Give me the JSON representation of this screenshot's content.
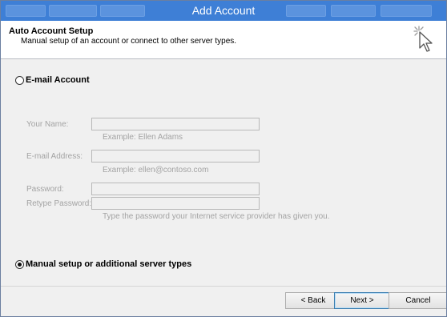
{
  "window": {
    "title": "Add Account"
  },
  "header": {
    "heading": "Auto Account Setup",
    "subheading": "Manual setup of an account or connect to other server types."
  },
  "email_option": {
    "label": "E-mail Account",
    "selected": false
  },
  "form": {
    "name_label": "Your Name:",
    "name_value": "",
    "name_hint": "Example: Ellen Adams",
    "email_label": "E-mail Address:",
    "email_value": "",
    "email_hint": "Example: ellen@contoso.com",
    "password_label": "Password:",
    "password_value": "",
    "retype_label": "Retype Password:",
    "retype_value": "",
    "password_hint": "Type the password your Internet service provider has given you."
  },
  "manual_option": {
    "label": "Manual setup or additional server types",
    "selected": true
  },
  "footer": {
    "back_label": "< Back",
    "next_label": "Next >",
    "cancel_label": "Cancel"
  },
  "colors": {
    "titlebar": "#3e7fd6",
    "disabled_text": "#a3a3a3",
    "dialog_bg": "#f0f0f0"
  }
}
